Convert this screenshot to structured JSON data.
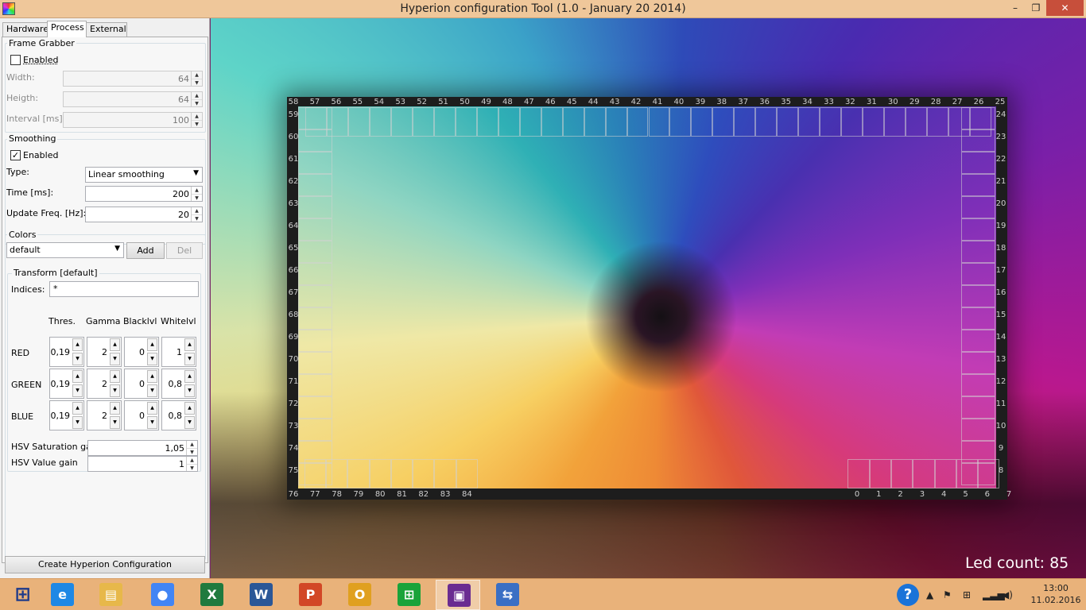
{
  "window": {
    "title": "Hyperion configuration Tool (1.0 - January 20 2014)",
    "min_glyph": "–",
    "max_glyph": "❐",
    "close_glyph": "✕"
  },
  "tabs": [
    "Hardware",
    "Process",
    "External"
  ],
  "active_tab": "Process",
  "frame_grabber": {
    "title": "Frame Grabber",
    "enabled_label": "Enabled",
    "enabled": false,
    "width_label": "Width:",
    "width": "64",
    "height_label": "Heigth:",
    "height": "64",
    "interval_label": "Interval [ms]:",
    "interval": "100"
  },
  "smoothing": {
    "title": "Smoothing",
    "enabled_label": "Enabled",
    "enabled": true,
    "type_label": "Type:",
    "type": "Linear smoothing",
    "time_label": "Time [ms]:",
    "time": "200",
    "freq_label": "Update Freq. [Hz]:",
    "freq": "20"
  },
  "colors": {
    "title": "Colors",
    "selected": "default",
    "add_label": "Add",
    "del_label": "Del",
    "transform": {
      "title": "Transform [default]",
      "indices_label": "Indices:",
      "indices": "*",
      "columns": [
        "Thres.",
        "Gamma",
        "Blacklvl",
        "Whitelvl"
      ],
      "rows": [
        {
          "label": "RED",
          "values": [
            "0,19",
            "2",
            "0",
            "1"
          ]
        },
        {
          "label": "GREEN",
          "values": [
            "0,19",
            "2",
            "0",
            "0,8"
          ]
        },
        {
          "label": "BLUE",
          "values": [
            "0,19",
            "2",
            "0",
            "0,8"
          ]
        }
      ],
      "hsv_sat_label": "HSV Saturation gain",
      "hsv_sat": "1,05",
      "hsv_val_label": "HSV Value gain",
      "hsv_val": "1"
    }
  },
  "create_button": "Create Hyperion Configuration",
  "preview": {
    "led_count_text": "Led count: 85",
    "top_numbers": [
      "58",
      "57",
      "56",
      "55",
      "54",
      "53",
      "52",
      "51",
      "50",
      "49",
      "48",
      "47",
      "46",
      "45",
      "44",
      "43",
      "42",
      "41",
      "40",
      "39",
      "38",
      "37",
      "36",
      "35",
      "34",
      "33",
      "32",
      "31",
      "30",
      "29",
      "28",
      "27",
      "26",
      "25"
    ],
    "left_numbers": [
      "59",
      "60",
      "61",
      "62",
      "63",
      "64",
      "65",
      "66",
      "67",
      "68",
      "69",
      "70",
      "71",
      "72",
      "73",
      "74",
      "75"
    ],
    "right_numbers": [
      "24",
      "23",
      "22",
      "21",
      "20",
      "19",
      "18",
      "17",
      "16",
      "15",
      "14",
      "13",
      "12",
      "11",
      "10",
      "9",
      "8"
    ],
    "bottom_left_numbers": [
      "76",
      "77",
      "78",
      "79",
      "80",
      "81",
      "82",
      "83",
      "84"
    ],
    "bottom_right_numbers": [
      "0",
      "1",
      "2",
      "3",
      "4",
      "5",
      "6",
      "7"
    ]
  },
  "taskbar": {
    "items": [
      {
        "name": "start-icon",
        "glyph": "⊞"
      },
      {
        "name": "internet-explorer-icon",
        "glyph": "e"
      },
      {
        "name": "file-explorer-icon",
        "glyph": "▤"
      },
      {
        "name": "chrome-icon",
        "glyph": "●"
      },
      {
        "name": "excel-icon",
        "glyph": "X"
      },
      {
        "name": "word-icon",
        "glyph": "W"
      },
      {
        "name": "powerpoint-icon",
        "glyph": "P"
      },
      {
        "name": "outlook-icon",
        "glyph": "O"
      },
      {
        "name": "store-icon",
        "glyph": "⊞"
      },
      {
        "name": "hyperion-app-icon",
        "glyph": "▣"
      },
      {
        "name": "network-tool-icon",
        "glyph": "⇆"
      }
    ],
    "colors": [
      "#e9b27a",
      "#1e88e5",
      "#e7b84a",
      "#4285f4",
      "#1f7a3e",
      "#2b5797",
      "#d24726",
      "#e0a020",
      "#1aa33a",
      "#6a2c91",
      "#3a6fc4"
    ],
    "time": "13:00",
    "date": "11.02.2016"
  }
}
